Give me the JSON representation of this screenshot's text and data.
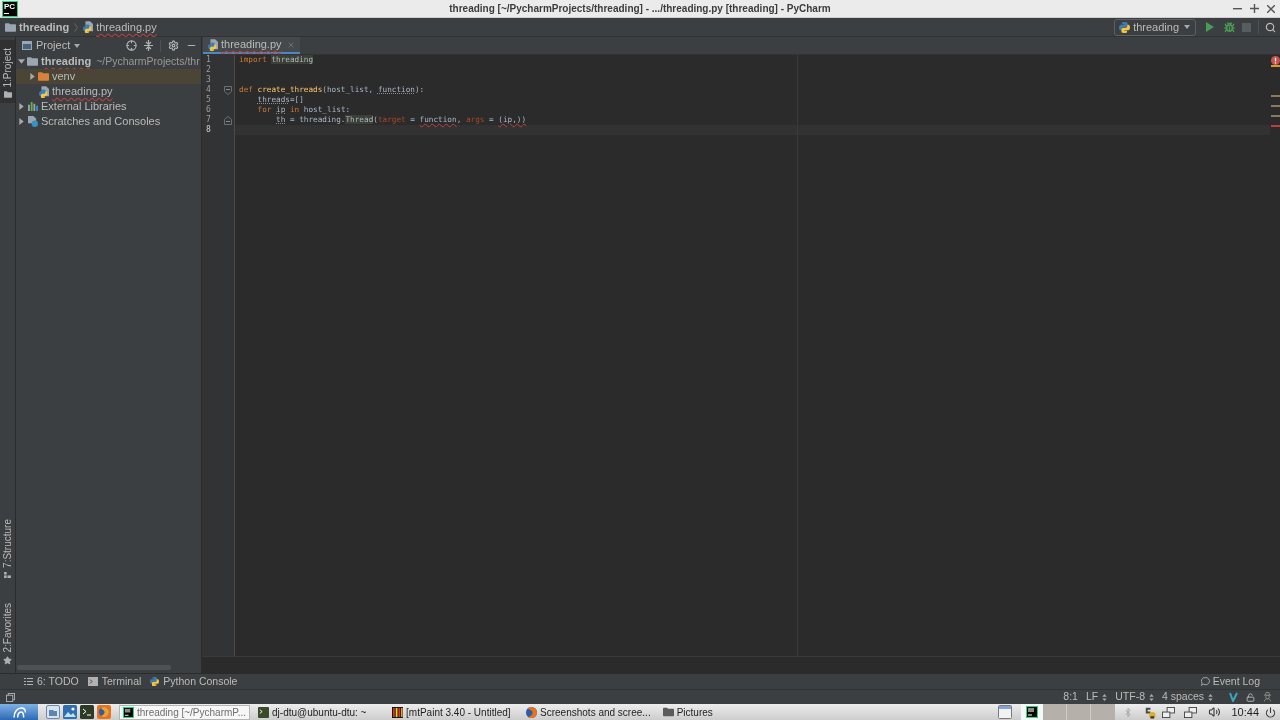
{
  "title_bar": {
    "logo": "PC",
    "title": "threading [~/PycharmProjects/threading] - .../threading.py [threading] - PyCharm"
  },
  "navigation_bar": {
    "breadcrumbs": [
      {
        "label": "threading",
        "kind": "folder",
        "error": false
      },
      {
        "label": "threading.py",
        "kind": "python_file",
        "error": true
      }
    ],
    "run_configuration": "threading"
  },
  "left_tool_strip": {
    "top": [
      {
        "label": "1:Project",
        "kind": "project",
        "selected": true
      }
    ],
    "bottom": [
      {
        "label": "7:Structure",
        "kind": "structure",
        "selected": false
      },
      {
        "label": "2:Favorites",
        "kind": "favorites",
        "selected": false
      }
    ]
  },
  "project_panel": {
    "title": "Project",
    "tree": [
      {
        "label": "threading",
        "path": "~/PycharmProjects/thr",
        "kind": "project_root",
        "error": true,
        "expanded": true,
        "children": [
          {
            "label": "venv",
            "kind": "excluded_folder",
            "error": false,
            "expanded": false
          },
          {
            "label": "threading.py",
            "kind": "python_file",
            "error": true
          }
        ]
      },
      {
        "label": "External Libraries",
        "kind": "libraries",
        "error": false,
        "expanded": false
      },
      {
        "label": "Scratches and Consoles",
        "kind": "scratches",
        "error": false,
        "expanded": false
      }
    ]
  },
  "editor": {
    "tabs": [
      {
        "label": "threading.py",
        "selected": true,
        "error": true
      }
    ],
    "inspection": {
      "kind": "error"
    },
    "lines": [
      {
        "number": "1",
        "current": false,
        "marker": {
          "kind": "warning"
        },
        "tokens": [
          {
            "text": "import",
            "kind": "keyword"
          },
          {
            "text": " threading",
            "kind": "usage_highlight"
          }
        ]
      },
      {
        "number": "2",
        "current": false
      },
      {
        "number": "3",
        "current": false
      },
      {
        "number": "4",
        "current": false,
        "fold": {
          "kind": "start"
        },
        "marker": {
          "kind": "weak_warning"
        },
        "tokens": [
          {
            "text": "def",
            "kind": "keyword"
          },
          {
            "text": " create_threads",
            "kind": "def_name"
          },
          {
            "text": "(host_list, ",
            "kind": "plain"
          },
          {
            "text": "function",
            "kind": "weak_warning"
          },
          {
            "text": "):",
            "kind": "plain"
          }
        ]
      },
      {
        "number": "5",
        "current": false,
        "marker": {
          "kind": "weak_warning"
        },
        "tokens": [
          {
            "text": "    threads",
            "kind": "weak_warning"
          },
          {
            "text": "=[]",
            "kind": "plain"
          }
        ]
      },
      {
        "number": "6",
        "current": false,
        "marker": {
          "kind": "weak_warning"
        },
        "tokens": [
          {
            "text": "    for",
            "kind": "keyword"
          },
          {
            "text": " ip",
            "kind": "weak_warning"
          },
          {
            "text": " in",
            "kind": "keyword"
          },
          {
            "text": " host_list:",
            "kind": "plain"
          }
        ]
      },
      {
        "number": "7",
        "current": false,
        "fold": {
          "kind": "end"
        },
        "marker": {
          "kind": "error"
        },
        "tokens": [
          {
            "text": "        th",
            "kind": "weak_warning"
          },
          {
            "text": " = threading.",
            "kind": "plain"
          },
          {
            "text": "Thread",
            "kind": "usage_highlight"
          },
          {
            "text": "(",
            "kind": "plain"
          },
          {
            "text": "target",
            "kind": "kwarg"
          },
          {
            "text": " = ",
            "kind": "plain"
          },
          {
            "text": "function",
            "kind": "error"
          },
          {
            "text": ", ",
            "kind": "plain"
          },
          {
            "text": "args",
            "kind": "kwarg"
          },
          {
            "text": " = ",
            "kind": "plain"
          },
          {
            "text": "(ip,))",
            "kind": "error"
          }
        ]
      },
      {
        "number": "8",
        "current": true
      }
    ]
  },
  "bottom_tool_bar": {
    "tools": [
      {
        "label": "6: TODO",
        "kind": "todo"
      },
      {
        "label": "Terminal",
        "kind": "terminal"
      },
      {
        "label": "Python Console",
        "kind": "python_console"
      }
    ],
    "event_log": "Event Log"
  },
  "status_bar": {
    "position": "8:1",
    "line_separator": "LF",
    "encoding": "UTF-8",
    "indent": "4 spaces"
  },
  "taskbar": {
    "windows": [
      {
        "label": "threading [~/PycharmP...",
        "kind": "pycharm",
        "selected": true
      },
      {
        "label": "dj-dtu@ubuntu-dtu: ~",
        "kind": "terminal",
        "selected": false
      },
      {
        "label": "[mtPaint 3.40 - Untitled]",
        "kind": "paint",
        "selected": false
      },
      {
        "label": "Screenshots and scree...",
        "kind": "browser",
        "selected": false
      },
      {
        "label": "Pictures",
        "kind": "folder",
        "selected": false
      }
    ],
    "clock": "10:44"
  }
}
